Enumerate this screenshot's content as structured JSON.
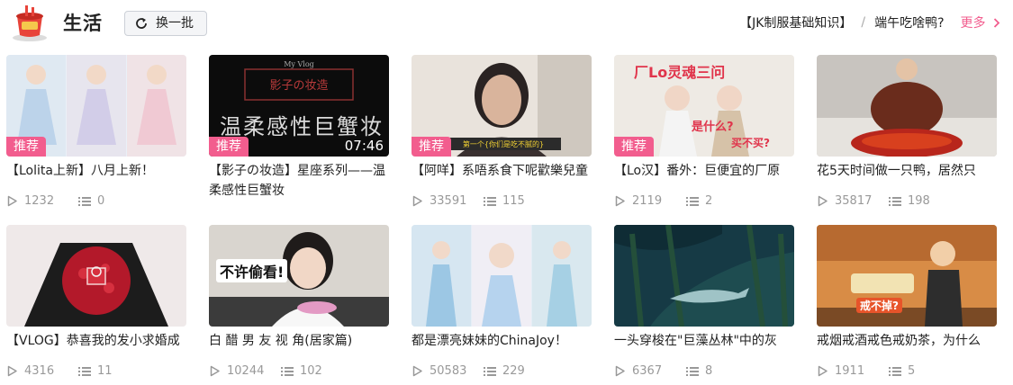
{
  "header": {
    "title": "生活",
    "refresh_label": "换一批",
    "tags": [
      "【JK制服基础知识】",
      "端午吃啥鸭?"
    ],
    "more_label": "更多"
  },
  "colors": {
    "accent": "#f25d8e",
    "muted": "#999999",
    "button_bg": "#f4f5f7"
  },
  "cards": [
    {
      "title": "【Lolita上新】八月上新！",
      "plays": "1232",
      "danmaku": "0",
      "badge": "推荐",
      "duration": "",
      "thumb_text": ""
    },
    {
      "title": "【影子の妆造】星座系列——温柔感性巨蟹妆",
      "plays": "",
      "danmaku": "",
      "badge": "推荐",
      "duration": "07:46",
      "thumb_text": "温柔感性巨蟹妆"
    },
    {
      "title": "【阿咩】系唔系食下呢歡樂兒童",
      "plays": "33591",
      "danmaku": "115",
      "badge": "推荐",
      "duration": "",
      "thumb_text": ""
    },
    {
      "title": "【Lo汉】番外：巨便宜的厂原",
      "plays": "2119",
      "danmaku": "2",
      "badge": "推荐",
      "duration": "",
      "thumb_text": "厂Lo灵魂三问"
    },
    {
      "title": "花5天时间做一只鸭，居然只",
      "plays": "35817",
      "danmaku": "198",
      "badge": "",
      "duration": "",
      "thumb_text": ""
    },
    {
      "title": "【VLOG】恭喜我的发小求婚成",
      "plays": "4316",
      "danmaku": "11",
      "badge": "",
      "duration": "",
      "thumb_text": ""
    },
    {
      "title": "白 醋 男 友 视 角(居家篇)",
      "plays": "10244",
      "danmaku": "102",
      "badge": "",
      "duration": "",
      "thumb_text": "不许偷看!"
    },
    {
      "title": "都是漂亮妹妹的ChinaJoy！",
      "plays": "50583",
      "danmaku": "229",
      "badge": "",
      "duration": "",
      "thumb_text": ""
    },
    {
      "title": "一头穿梭在\"巨藻丛林\"中的灰",
      "plays": "6367",
      "danmaku": "8",
      "badge": "",
      "duration": "",
      "thumb_text": ""
    },
    {
      "title": "戒烟戒酒戒色戒奶茶，为什么",
      "plays": "1911",
      "danmaku": "5",
      "badge": "",
      "duration": "",
      "thumb_text": "戒不掉?"
    }
  ]
}
